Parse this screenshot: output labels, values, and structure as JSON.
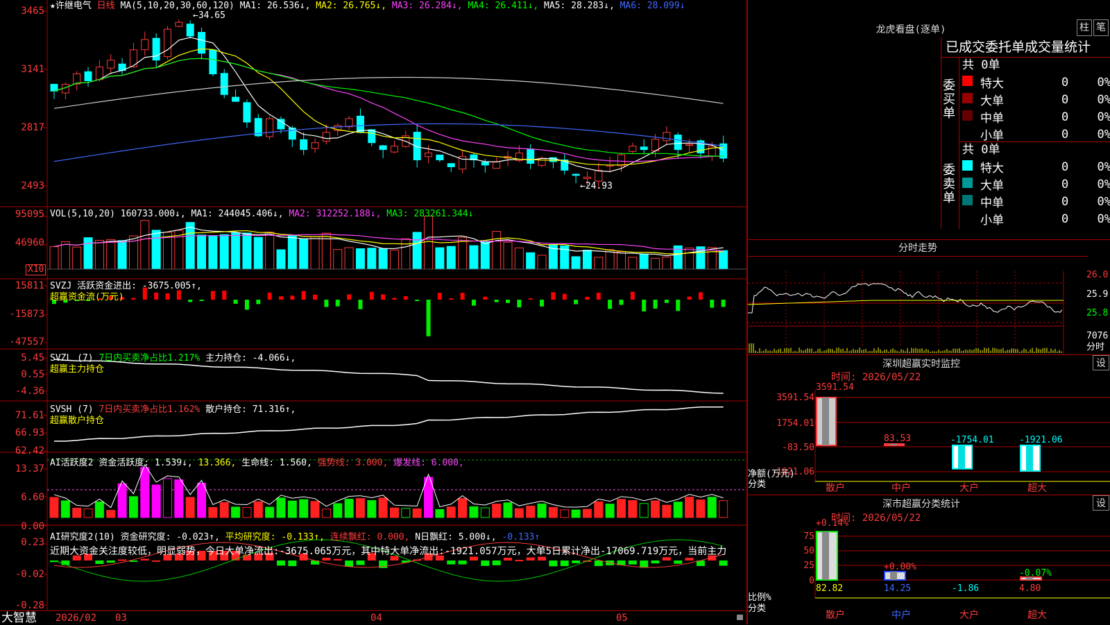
{
  "stock": {
    "star": "★",
    "name": "许继电气",
    "period": "日线"
  },
  "ma_header": {
    "params": "MA(5,10,20,30,60,120)",
    "items": [
      {
        "label": "MA1: 26.536↓,",
        "color": "#ffffff"
      },
      {
        "label": "MA2: 26.765↓,",
        "color": "#ffff00"
      },
      {
        "label": "MA3: 26.284↓,",
        "color": "#ff44ff"
      },
      {
        "label": "MA4: 26.411↓,",
        "color": "#00ff00"
      },
      {
        "label": "MA5: 28.283↓,",
        "color": "#ffffff"
      },
      {
        "label": "MA6: 28.099↓",
        "color": "#4169ff"
      }
    ],
    "high_mark": "34.65",
    "low_mark": "24.93"
  },
  "axes": {
    "price": [
      "3465",
      "3141",
      "2817",
      "2493"
    ],
    "vol": [
      "95095",
      "46960"
    ],
    "vol_unit": "X10",
    "svzj": [
      "15811",
      "-15873",
      "-47557"
    ],
    "svzl": [
      "5.45",
      "0.55",
      "-4.36"
    ],
    "svsh": [
      "71.61",
      "66.93",
      "62.42"
    ],
    "ai1": [
      "13.37",
      "6.60",
      "0.00"
    ],
    "ai2": [
      "0.23",
      "-0.02",
      "-0.28"
    ]
  },
  "vol_header": {
    "params": "VOL(5,10,20)",
    "value": "160733.000↓,",
    "ma1": "MA1: 244045.406↓,",
    "ma2": "MA2: 312252.188↓,",
    "ma3": "MA3: 283261.344↓"
  },
  "svzj_header": {
    "title": "SVZJ  活跃资金进出: -3675.005↑,",
    "sub": "超赢资金流(万元)"
  },
  "svzl_header": {
    "title": "SVZL (7)",
    "ratio": "7日内买卖净占比1.217%",
    "hold": "主力持仓: -4.066↓,",
    "sub": "超赢主力持仓"
  },
  "svsh_header": {
    "title": "SVSH (7)",
    "ratio": "7日内买卖净占比1.162%",
    "hold": "散户持仓: 71.316↑,",
    "sub": "超赢散户持仓"
  },
  "ai1_header": {
    "title": "AI活跃度2",
    "act": "资金活跃度: 1.539↓,",
    "v2": "13.366,",
    "life": "生命线: 1.560,",
    "strong": "强势线: 3.000,",
    "burst": "爆发线: 6.000,"
  },
  "ai2_header": {
    "title": "AI研究度2(10)",
    "res": "资金研究度: -0.023↑,",
    "avg": "平均研究度: -0.133↑,",
    "cont": "连续飘红: 0.000,",
    "nday": "N日飘红: 5.000↓,",
    "v5": "-0.133↑"
  },
  "comment": "近期大资金关注度较低，明显弱势，今日大单净流出:-3675.065万元，其中特大单净流出:-1921.057万元，大单5日累计净出-17069.719万元，当前主力",
  "date_axis": {
    "brand": "大智慧",
    "labels": [
      "2026/02",
      "03",
      "04",
      "05"
    ]
  },
  "lhb": {
    "title": "龙虎看盘(逐单)",
    "btn1": "柱",
    "btn2": "笔",
    "subtitle": "已成交委托单成交量统计",
    "buy_label": "委买单",
    "sell_label": "委卖单",
    "buy_total": "共 0单",
    "sell_total": "共 0单",
    "buy_rows": [
      {
        "name": "特大",
        "v": "0",
        "p": "0%",
        "color": "#ff0000"
      },
      {
        "name": "大单",
        "v": "0",
        "p": "0%",
        "color": "#990000"
      },
      {
        "name": "中单",
        "v": "0",
        "p": "0%",
        "color": "#660000"
      },
      {
        "name": "小单",
        "v": "0",
        "p": "0%",
        "color": "#000000"
      }
    ],
    "sell_rows": [
      {
        "name": "特大",
        "v": "0",
        "p": "0%",
        "color": "#00ffff"
      },
      {
        "name": "大单",
        "v": "0",
        "p": "0%",
        "color": "#009999"
      },
      {
        "name": "中单",
        "v": "0",
        "p": "0%",
        "color": "#007777"
      },
      {
        "name": "小单",
        "v": "0",
        "p": "0%",
        "color": "#000000"
      }
    ]
  },
  "intraday": {
    "title": "分时走势",
    "p1": "26.0",
    "p2": "25.9",
    "p3": "25.8",
    "vol": "7076",
    "unit": "分时"
  },
  "monitor": {
    "title": "深圳超赢实时监控",
    "btn": "设",
    "time": "时间: 2026/05/22",
    "axis": [
      "3591.54",
      "1754.01",
      "-83.50",
      "-1921.06"
    ],
    "unit1": "净额(万元)",
    "unit2": "分类",
    "bars": [
      {
        "cat": "散户",
        "value": "3591.54"
      },
      {
        "cat": "中户",
        "value": "83.53"
      },
      {
        "cat": "大户",
        "value": "-1754.01"
      },
      {
        "cat": "超大",
        "value": "-1921.06"
      }
    ]
  },
  "classify": {
    "title": "深市超赢分类统计",
    "btn": "设",
    "time": "时间: 2026/05/22",
    "axis": [
      "75",
      "50",
      "25",
      "0"
    ],
    "unit1": "比例%",
    "unit2": "分类",
    "bars": [
      {
        "cat": "散户",
        "top": "+0.14%",
        "bottom": "82.82"
      },
      {
        "cat": "中户",
        "top": "+0.00%",
        "bottom": "14.25"
      },
      {
        "cat": "大户",
        "top": "",
        "bottom": "-1.86"
      },
      {
        "cat": "超大",
        "top": "-0.07%",
        "bottom": "4.80"
      }
    ]
  },
  "chart_data": {
    "type": "candlestick",
    "title": "许继电气 日线",
    "x_range": [
      "2026/02",
      "2026/05"
    ],
    "price_range": [
      24.93,
      34.65
    ],
    "ma_last": {
      "MA1": 26.536,
      "MA2": 26.765,
      "MA3": 26.284,
      "MA4": 26.411,
      "MA5": 28.283,
      "MA6": 28.099
    },
    "volume_last": 160733.0,
    "intraday_range": [
      25.8,
      26.0
    ],
    "monitor_net": {
      "散户": 3591.54,
      "中户": 83.53,
      "大户": -1754.01,
      "超大": -1921.06
    },
    "classify_pct": {
      "散户": 82.82,
      "中户": 14.25,
      "大户": -1.86,
      "超大": 4.8
    }
  },
  "colors": {
    "up": "#ff3b3b",
    "down": "#00ffff",
    "grid": "#aa0000"
  }
}
